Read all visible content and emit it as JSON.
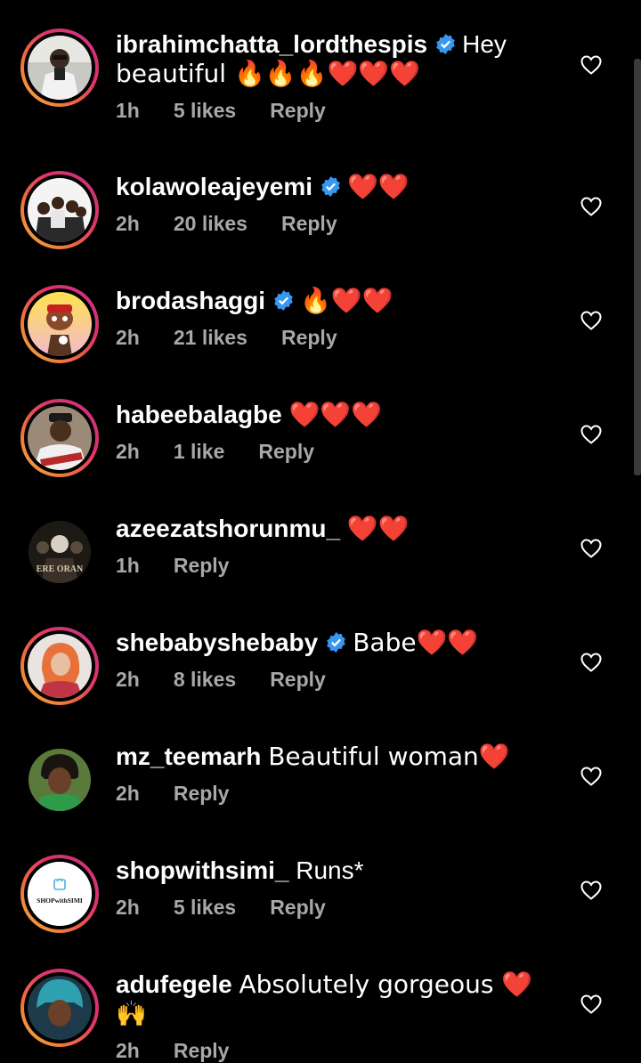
{
  "comments": [
    {
      "username": "ibrahimchatta_lordthespis",
      "verified": true,
      "text_line1": "Hey",
      "text_line2": "beautiful 🔥🔥🔥❤️❤️❤️",
      "time": "1h",
      "likes": "5 likes",
      "reply": "Reply",
      "avatar": "person-sunglasses",
      "ring": true
    },
    {
      "username": "kolawoleajeyemi",
      "verified": true,
      "text": "❤️❤️",
      "time": "2h",
      "likes": "20 likes",
      "reply": "Reply",
      "avatar": "family-photo",
      "ring": true
    },
    {
      "username": "brodashaggi",
      "verified": true,
      "text": "🔥❤️❤️",
      "time": "2h",
      "likes": "21 likes",
      "reply": "Reply",
      "avatar": "cartoon-character",
      "ring": true
    },
    {
      "username": "habeebalagbe",
      "verified": false,
      "text": "❤️❤️❤️",
      "time": "2h",
      "likes": "1 like",
      "reply": "Reply",
      "avatar": "man-cap",
      "ring": true
    },
    {
      "username": "azeezatshorunmu_",
      "verified": false,
      "text": "❤️❤️",
      "time": "1h",
      "likes": "",
      "reply": "Reply",
      "avatar": "movie-poster",
      "avatar_text": "ERE ORAN",
      "ring": false
    },
    {
      "username": "shebabyshebaby",
      "verified": true,
      "text": "Babe❤️❤️",
      "time": "2h",
      "likes": "8 likes",
      "reply": "Reply",
      "avatar": "woman-red",
      "ring": true
    },
    {
      "username": "mz_teemarh",
      "verified": false,
      "text": "Beautiful woman❤️",
      "time": "2h",
      "likes": "",
      "reply": "Reply",
      "avatar": "woman-green",
      "ring": false
    },
    {
      "username": "shopwithsimi_",
      "verified": false,
      "text": "Runs*",
      "time": "2h",
      "likes": "5 likes",
      "reply": "Reply",
      "avatar": "shop-logo",
      "avatar_text": "SHOPwithSIMI",
      "ring": true
    },
    {
      "username": "adufegele",
      "verified": false,
      "text": "Absolutely gorgeous ❤️🙌",
      "time": "2h",
      "likes": "",
      "reply": "Reply",
      "avatar": "woman-gele",
      "ring": true
    }
  ],
  "colors": {
    "background": "#000000",
    "meta": "#a8a8a8",
    "verified": "#3897f0"
  },
  "icons": {
    "like": "heart-outline-icon",
    "verified": "verified-badge-icon"
  }
}
